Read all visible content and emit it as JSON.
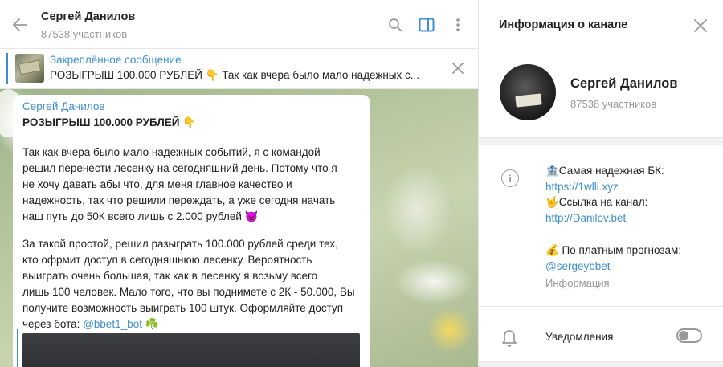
{
  "chat": {
    "title": "Сергей Данилов",
    "subtitle": "87538 участников",
    "icons": {
      "back": "back-arrow-icon",
      "search": "search-icon",
      "info_panel": "sidebar-toggle-icon",
      "menu": "more-vertical-icon"
    },
    "accent_color": "#3d8fd1"
  },
  "pinned": {
    "title": "Закреплённое сообщение",
    "text": "РОЗЫГРЫШ 100.000 РУБЛЕЙ 👇  Так как вчера было мало надежных с..."
  },
  "message": {
    "author": "Сергей Данилов",
    "title": "РОЗЫГРЫШ 100.000 РУБЛЕЙ 👇",
    "lines": [
      "Так как вчера было мало надежных событий, я с командой",
      "решил перенести лесенку на сегодняшний день. Потому что я",
      "не хочу давать абы что, для меня главное качество и",
      "надежность, так что решили переждать, а уже сегодня начать",
      "наш путь до 50К всего лишь с 2.000 рублей 😈",
      "За такой простой, решил разыграть 100.000 рублей среди тех,",
      "кто офрмит доступ в сегодняшнюю лесенку. Вероятность",
      "выиграть очень большая, так как в лесенку я возьму всего",
      "лишь 100 человек. Мало того, что вы поднимете с 2К - 50.000, Вы",
      "получите возможность выиграть 100 штук. Оформляйте доступ"
    ],
    "last_line_prefix": "через бота: ",
    "last_line_link": "@bbet1_bot",
    "last_line_suffix": " ☘️"
  },
  "info_panel": {
    "title": "Информация о канале",
    "name": "Сергей Данилов",
    "subtitle": "87538 участников",
    "description": {
      "line1": "🏦Самая надежная БК:",
      "link1": "https://1wlli.xyz",
      "line2": "🤟Ссылка на канал:",
      "link2": "http://Danilov.bet",
      "line3": "💰 По платным прогнозам:",
      "link3": "@sergeybbet",
      "label": "Информация"
    },
    "notifications_label": "Уведомления",
    "notifications_on": false
  }
}
